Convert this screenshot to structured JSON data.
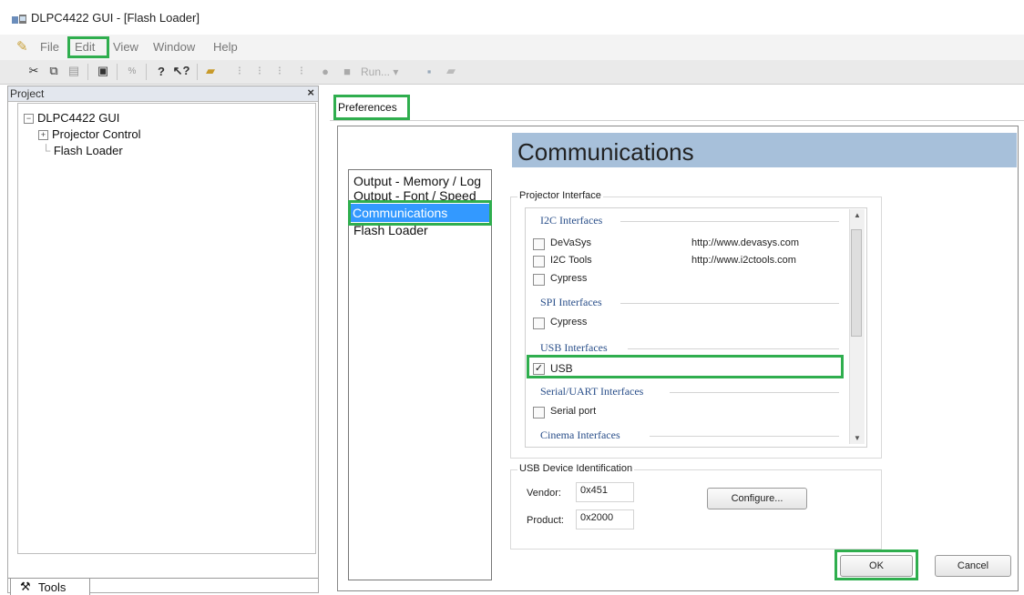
{
  "window": {
    "title": "DLPC4422 GUI - [Flash Loader]"
  },
  "menu": {
    "items": [
      "File",
      "Edit",
      "View",
      "Window",
      "Help"
    ]
  },
  "toolbar": {
    "run_label": "Run...",
    "icons": [
      "cut-icon",
      "copy-icon",
      "paste-icon",
      "properties-icon",
      "percent-icon",
      "help-icon",
      "context-help-icon",
      "open-folder-icon",
      "step1-icon",
      "step2-icon",
      "step3-icon",
      "step4-icon",
      "record-icon",
      "stop-icon",
      "run-dropdown",
      "save-icon",
      "open-icon"
    ]
  },
  "project_panel": {
    "header": "Project",
    "close_glyph": "×",
    "tree": {
      "root": "DLPC4422 GUI",
      "child1": "Projector Control",
      "child2": "Flash Loader"
    },
    "tools_tab": "Tools"
  },
  "preferences": {
    "tab_label": "Preferences",
    "header": "Communications",
    "categories": [
      "Output - Memory / Log",
      "Output - Font / Speed",
      "Communications",
      "Flash Loader"
    ],
    "selected_category": "Communications",
    "projector_interface": {
      "label": "Projector Interface",
      "sections": {
        "i2c": "I2C Interfaces",
        "spi": "SPI Interfaces",
        "usb": "USB Interfaces",
        "serial": "Serial/UART Interfaces",
        "cinema": "Cinema Interfaces"
      },
      "options": {
        "devasys": {
          "label": "DeVaSys",
          "url": "http://www.devasys.com",
          "checked": false
        },
        "i2ctools": {
          "label": "I2C Tools",
          "url": "http://www.i2ctools.com",
          "checked": false
        },
        "cypress_i2c": {
          "label": "Cypress",
          "checked": false
        },
        "cypress_spi": {
          "label": "Cypress",
          "checked": false
        },
        "usb": {
          "label": "USB",
          "checked": true
        },
        "serial": {
          "label": "Serial port",
          "checked": false
        }
      }
    },
    "usb_device": {
      "label": "USB Device Identification",
      "vendor_label": "Vendor:",
      "vendor_value": "0x451",
      "product_label": "Product:",
      "product_value": "0x2000",
      "configure_label": "Configure..."
    },
    "buttons": {
      "ok": "OK",
      "cancel": "Cancel"
    }
  },
  "colors": {
    "highlight": "#2fae4e",
    "selection": "#3399ff",
    "header_bg": "#a7c0da",
    "section_text": "#2a4f8a"
  }
}
